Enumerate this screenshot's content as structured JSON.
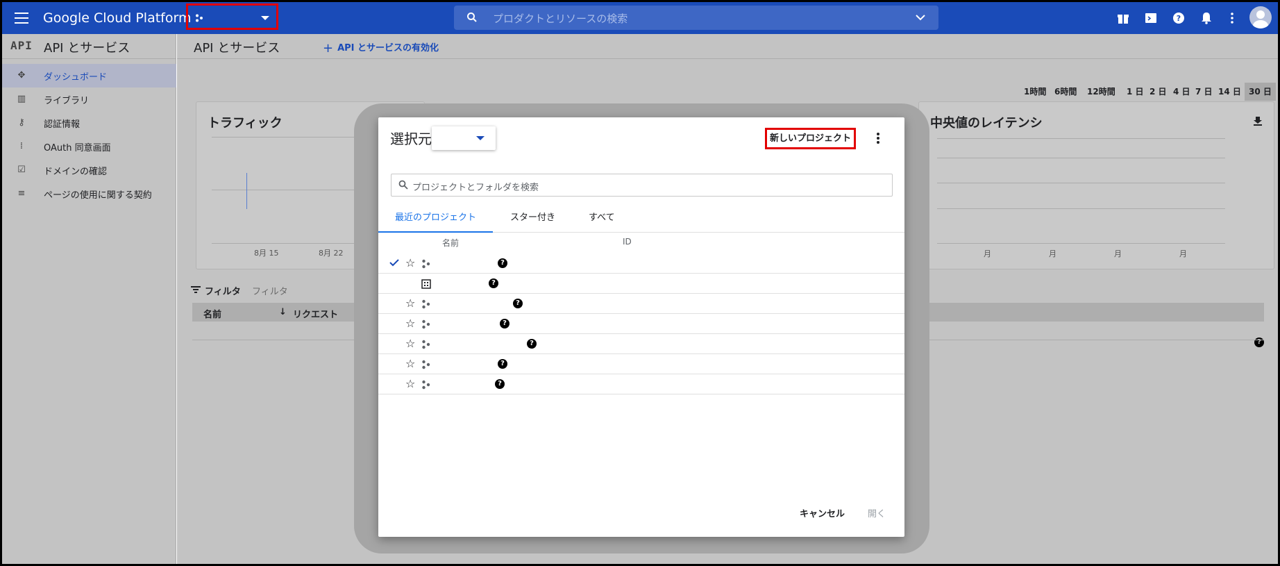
{
  "topbar": {
    "brand": "Google Cloud Platform",
    "search_placeholder": "プロダクトとリソースの検索"
  },
  "sidebar": {
    "api_logo": "API",
    "title": "API とサービス",
    "items": [
      {
        "label": "ダッシュボード",
        "icon": "dashboard-icon",
        "active": true
      },
      {
        "label": "ライブラリ",
        "icon": "library-icon"
      },
      {
        "label": "認証情報",
        "icon": "key-icon"
      },
      {
        "label": "OAuth 同意画面",
        "icon": "oauth-icon"
      },
      {
        "label": "ドメインの確認",
        "icon": "checkbox-icon"
      },
      {
        "label": "ページの使用に関する契約",
        "icon": "settings-list-icon"
      }
    ]
  },
  "main": {
    "title": "API とサービス",
    "enable_api": "API とサービスの有効化",
    "time_ranges": [
      "1時間",
      "6時間",
      "12時間",
      "1 日",
      "2 日",
      "4 日",
      "7 日",
      "14 日",
      "30 日"
    ],
    "selected_range": "30 日",
    "traffic_card": {
      "title": "トラフィック",
      "x_ticks": [
        "8月 15",
        "8月 22"
      ]
    },
    "latency_card": {
      "title": "中央値のレイテンシ",
      "x_ticks": [
        "月",
        "月",
        "月",
        "月"
      ]
    },
    "filter_label": "フィルタ",
    "filter_placeholder": "フィルタ",
    "table_headers": [
      "名前",
      "リクエスト"
    ]
  },
  "dialog": {
    "title": "選択元",
    "new_project": "新しいプロジェクト",
    "search_placeholder": "プロジェクトとフォルダを検索",
    "tabs": [
      "最近のプロジェクト",
      "スター付き",
      "すべて"
    ],
    "active_tab": "最近のプロジェクト",
    "columns": [
      "名前",
      "ID"
    ],
    "rows": [
      {
        "type": "project",
        "checked": true,
        "starrable": true
      },
      {
        "type": "organization",
        "checked": false,
        "starrable": false
      },
      {
        "type": "project",
        "checked": false,
        "starrable": true
      },
      {
        "type": "project",
        "checked": false,
        "starrable": true
      },
      {
        "type": "project",
        "checked": false,
        "starrable": true
      },
      {
        "type": "project",
        "checked": false,
        "starrable": true
      },
      {
        "type": "project",
        "checked": false,
        "starrable": true
      }
    ],
    "cancel": "キャンセル",
    "open": "開く"
  },
  "colors": {
    "brand_blue": "#1a4bb8",
    "link_blue": "#1a73e8",
    "highlight_red": "#e20000",
    "scrim_gray": "#c3c3c3"
  }
}
